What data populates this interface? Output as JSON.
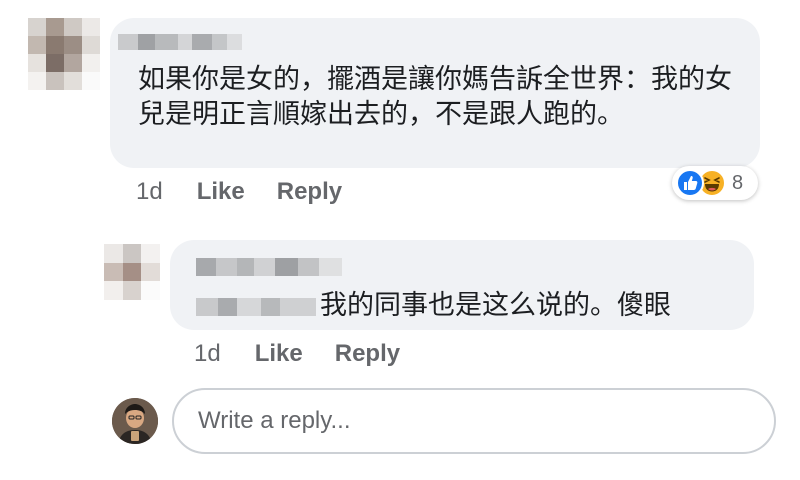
{
  "comments": [
    {
      "text": "如果你是女的，擺酒是讓你媽告訴全世界：我的女兒是明正言順嫁出去的，不是跟人跑的。",
      "time": "1d",
      "like_label": "Like",
      "reply_label": "Reply",
      "reactions": {
        "icons": [
          "like-icon",
          "haha-icon"
        ],
        "count": "8"
      }
    },
    {
      "text": "我的同事也是这么说的。傻眼",
      "time": "1d",
      "like_label": "Like",
      "reply_label": "Reply"
    }
  ],
  "reply_input": {
    "placeholder": "Write a reply..."
  },
  "colors": {
    "bubble": "#f0f2f5",
    "meta_text": "#65676b",
    "like_blue": "#1877f2",
    "haha_yellow": "#f7b125"
  }
}
